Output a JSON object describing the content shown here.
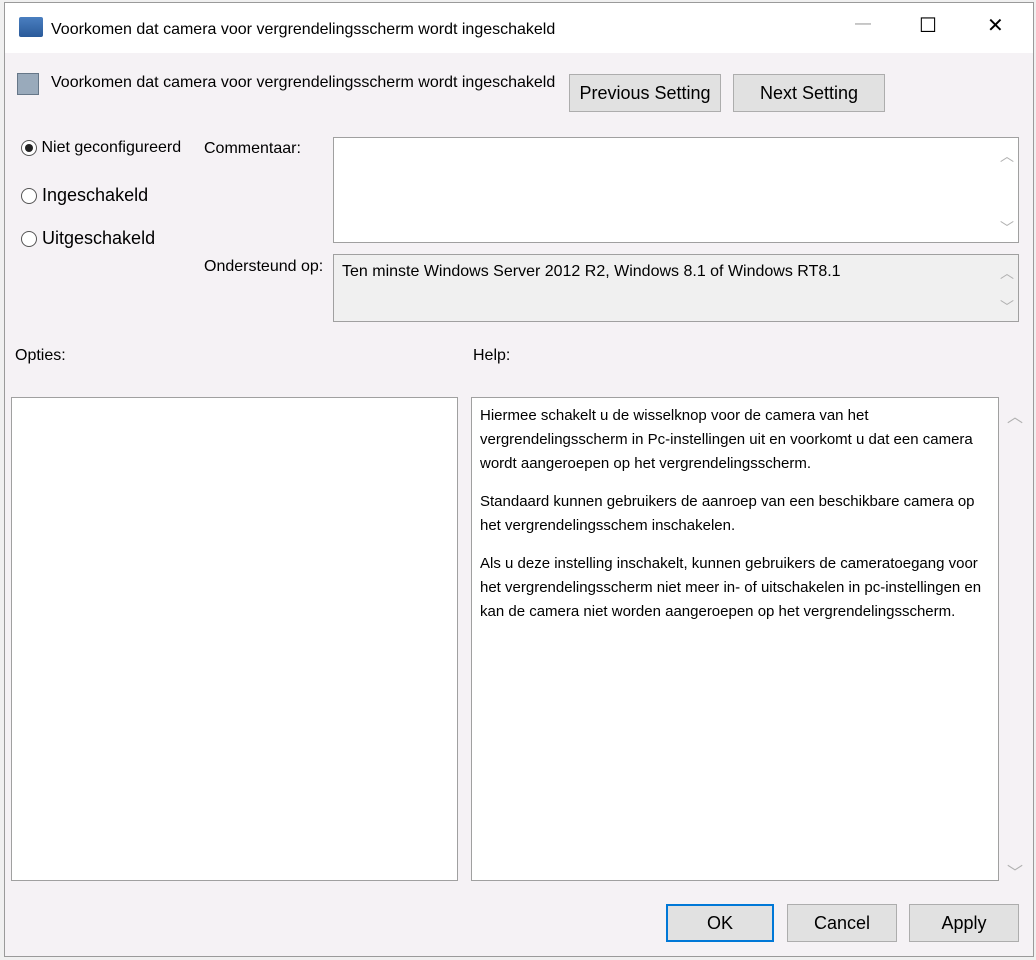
{
  "window": {
    "title": "Voorkomen dat camera voor vergrendelingsscherm wordt ingeschakeld",
    "minimize": "—",
    "maximize": "☐",
    "close": "✕"
  },
  "header": {
    "setting_title": "Voorkomen dat camera voor vergrendelingsscherm wordt ingeschakeld",
    "previous_label": "Previous Setting",
    "next_label": "Next Setting"
  },
  "state": {
    "options": [
      {
        "label": "Niet geconfigureerd",
        "selected": true
      },
      {
        "label": "Ingeschakeld",
        "selected": false
      },
      {
        "label": "Uitgeschakeld",
        "selected": false
      }
    ]
  },
  "comment": {
    "label": "Commentaar:",
    "value": ""
  },
  "supported": {
    "label": "Ondersteund op:",
    "value": "Ten minste Windows Server 2012 R2, Windows 8.1 of Windows RT8.1"
  },
  "options_label": "Opties:",
  "help": {
    "label": "Help:",
    "paragraphs": [
      "Hiermee schakelt u de wisselknop voor de camera van het vergrendelingsscherm in Pc-instellingen uit en voorkomt u dat een camera wordt aangeroepen op het vergrendelingsscherm.",
      "Standaard kunnen gebruikers de aanroep van een beschikbare camera op het vergrendelingsschem inschakelen.",
      "Als u deze instelling inschakelt, kunnen gebruikers de cameratoegang voor het vergrendelingsscherm niet meer in- of uitschakelen in pc-instellingen en kan de camera niet worden aangeroepen op het vergrendelingsscherm."
    ]
  },
  "footer": {
    "ok": "OK",
    "cancel": "Cancel",
    "apply": "Apply"
  }
}
